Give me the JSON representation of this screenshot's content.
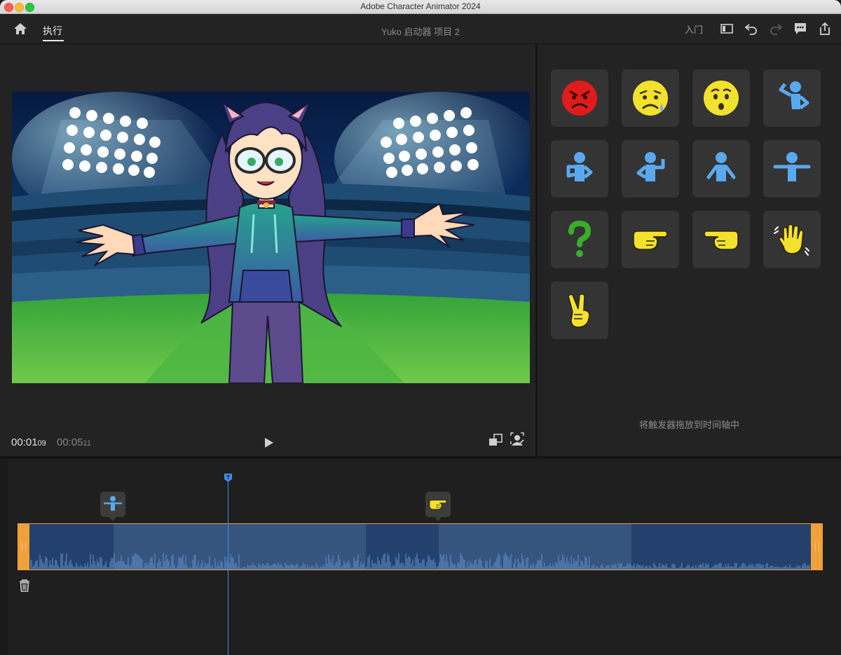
{
  "window": {
    "title": "Adobe Character Animator 2024"
  },
  "header": {
    "tab_perform": "执行",
    "project_title": "Yuko 启动器 项目 2",
    "get_started": "入门"
  },
  "stage": {
    "current_time_main": "00:01",
    "current_time_frames": "09",
    "total_time_main": "00:05",
    "total_time_frames": "11"
  },
  "triggers": {
    "items": [
      {
        "name": "angry-face",
        "color": "#e01b1b"
      },
      {
        "name": "sad-face",
        "color": "#f2e22e"
      },
      {
        "name": "surprised-face",
        "color": "#f2e22e"
      },
      {
        "name": "hand-on-head-pose",
        "color": "#5aa9f0"
      },
      {
        "name": "hands-on-hips-pose",
        "color": "#5aa9f0"
      },
      {
        "name": "shrug-pose",
        "color": "#5aa9f0"
      },
      {
        "name": "arms-down-pose",
        "color": "#5aa9f0"
      },
      {
        "name": "arms-out-pose",
        "color": "#5aa9f0"
      },
      {
        "name": "question-mark",
        "color": "#3aae2a"
      },
      {
        "name": "point-right-hand",
        "color": "#f2e22e"
      },
      {
        "name": "point-left-hand",
        "color": "#f2e22e"
      },
      {
        "name": "wave-hand",
        "color": "#f2e22e"
      },
      {
        "name": "peace-hand",
        "color": "#f2e22e"
      }
    ],
    "drag_hint": "将触发器拖放到时间轴中"
  },
  "timeline": {
    "accent": "#3f8be6",
    "track_border": "#ee9a30",
    "markers": [
      "arms-out-pose",
      "point-right-hand"
    ]
  }
}
